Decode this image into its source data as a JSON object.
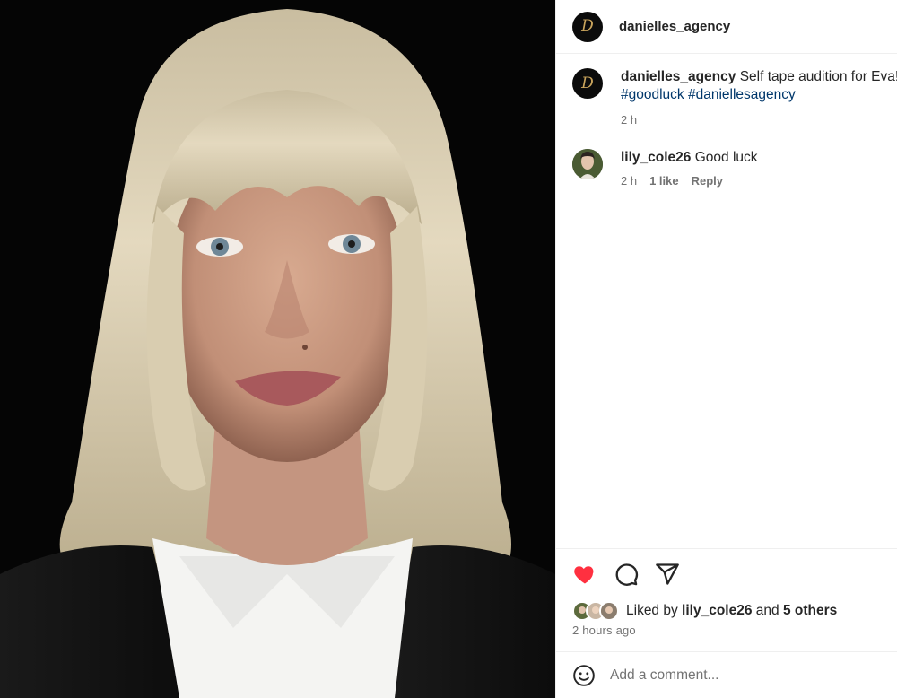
{
  "post": {
    "account": "danielles_agency",
    "logo_letter": "D"
  },
  "caption": {
    "username": "danielles_agency",
    "text": "Self tape audition for Eva!",
    "hashtags": [
      "#goodluck",
      "#daniellesagency"
    ],
    "time": "2 h"
  },
  "comments": [
    {
      "username": "lily_cole26",
      "text": "Good luck",
      "time": "2 h",
      "likes": "1 like",
      "reply": "Reply"
    }
  ],
  "actions": {
    "like_icon": "heart-filled-icon",
    "comment_icon": "comment-bubble-icon",
    "share_icon": "paper-plane-icon",
    "liked_color": "#ff3040"
  },
  "likes": {
    "prefix": "Liked by",
    "user": "lily_cole26",
    "and": "and",
    "others": "5 others"
  },
  "timestamp": "2 hours ago",
  "add_comment": {
    "emoji_icon": "smiley-icon",
    "placeholder": "Add a comment..."
  }
}
